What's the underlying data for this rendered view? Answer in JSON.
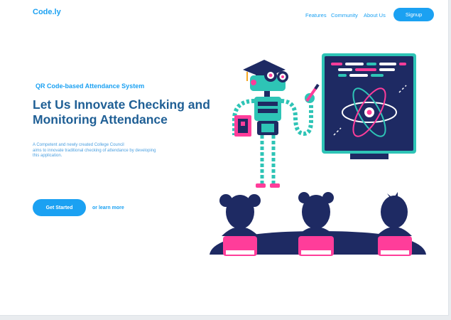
{
  "brand": {
    "logo": "Code.ly"
  },
  "nav": {
    "items": [
      "Features",
      "Community",
      "About Us"
    ],
    "signup_label": "Signup"
  },
  "hero": {
    "eyebrow": "QR Code-based Attendance System",
    "title_line1": "Let Us Innovate Checking and",
    "title_line2": "Monitoring Attendance",
    "desc_line1": "A Competent and newly created College Council",
    "desc_line2": "aims to innovate traditional checking of attendance by developing",
    "desc_line3": "this application.",
    "cta_label": "Get Started",
    "learn_label": "or learn more"
  },
  "colors": {
    "accent": "#1ba1f2",
    "heading": "#1f5f95",
    "navy": "#1e2a63",
    "teal": "#2ec4b6",
    "pink": "#ff3d9a"
  },
  "illustration": {
    "name": "robot-teacher-classroom"
  }
}
